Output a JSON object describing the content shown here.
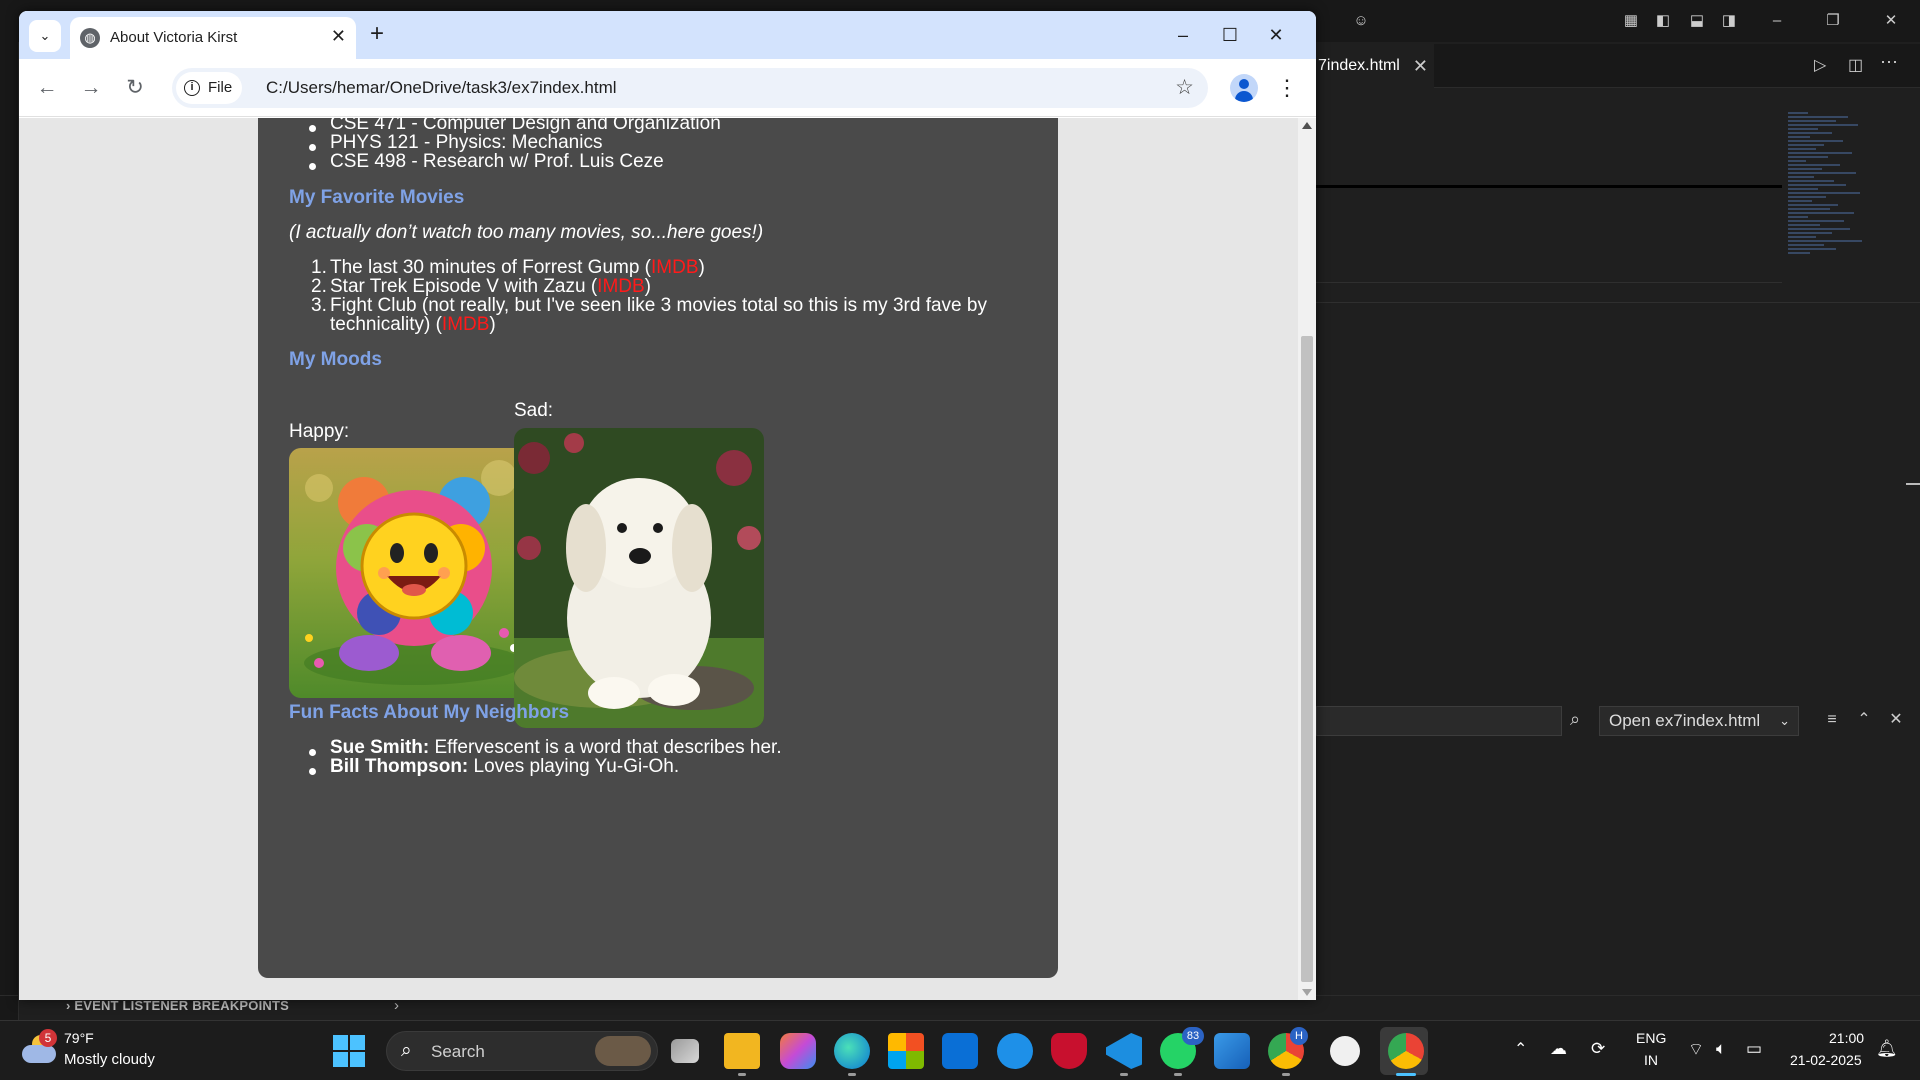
{
  "vscode": {
    "tab_label": "7index.html",
    "tab_close": "✕",
    "find_select_value": "Open ex7index.html",
    "breakpoints_label": "EVENT LISTENER BREAKPOINTS"
  },
  "browser": {
    "tab_title": "About Victoria Kirst",
    "url_scheme_label": "File",
    "url": "C:/Users/hemar/OneDrive/task3/ex7index.html",
    "icons": [
      "tab-search-icon",
      "globe-icon",
      "close-icon",
      "new-tab-icon",
      "minimize-icon",
      "maximize-icon",
      "close-window-icon",
      "back-icon",
      "forward-icon",
      "reload-icon",
      "info-icon",
      "star-icon",
      "profile-icon",
      "menu-icon"
    ]
  },
  "page": {
    "courses": [
      "CSE 471 - Computer Design and Organization",
      "PHYS 121 - Physics: Mechanics",
      "CSE 498 - Research w/ Prof. Luis Ceze"
    ],
    "movies_heading": "My Favorite Movies",
    "movies_intro": "(I actually don’t watch too many movies, so...here goes!)",
    "movies": [
      {
        "num": "1.",
        "text": "The last 30 minutes of Forrest Gump (",
        "link": "IMDB",
        "close": ")"
      },
      {
        "num": "2.",
        "text": "Star Trek Episode V with Zazu (",
        "link": "IMDB",
        "close": ")"
      },
      {
        "num": "3.",
        "text": "Fight Club (not really, but I've seen like 3 movies total so this is my 3rd fave by",
        "text2": "technicality) (",
        "link": "IMDB",
        "close": ")"
      }
    ],
    "moods_heading": "My Moods",
    "happy_label": "Happy:",
    "sad_label": "Sad:",
    "neighbors_heading": "Fun Facts About My Neighbors",
    "neighbors": [
      {
        "name": "Sue Smith:",
        "fact": " Effervescent is a word that describes her."
      },
      {
        "name": "Bill Thompson:",
        "fact": " Loves playing Yu-Gi-Oh."
      }
    ],
    "colors": {
      "card": "#4a4a4a",
      "heading": "#7fa2e6",
      "link": "#ff1a1a"
    }
  },
  "taskbar": {
    "weather_badge": "5",
    "weather_temp": "79°F",
    "weather_desc": "Mostly cloudy",
    "search_placeholder": "Search",
    "badge_whatsapp": "83",
    "badge_chrome_profile": "H",
    "lang_1": "ENG",
    "lang_2": "IN",
    "time": "21:00",
    "date": "21-02-2025"
  }
}
